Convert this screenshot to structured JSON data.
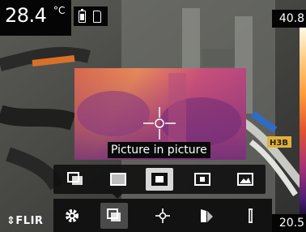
{
  "readout": {
    "value": "28.4",
    "unit": "°C"
  },
  "status": {
    "battery_icon": "battery-icon",
    "sd_card_icon": "sd-card-icon"
  },
  "scale": {
    "max": "40.8",
    "min": "20.5"
  },
  "pip": {
    "caption": "Picture in picture"
  },
  "image_modes": {
    "items": [
      {
        "icon": "fusion-mode-icon",
        "active": false
      },
      {
        "icon": "thermal-mode-icon",
        "active": false
      },
      {
        "icon": "picture-in-picture-icon",
        "active": true
      },
      {
        "icon": "small-pip-icon",
        "active": false
      },
      {
        "icon": "digital-camera-icon",
        "active": false
      }
    ]
  },
  "toolbar": {
    "items": [
      {
        "icon": "settings-gear-icon",
        "selected": false
      },
      {
        "icon": "image-mode-icon",
        "selected": true
      },
      {
        "icon": "spotmeter-crosshair-icon",
        "selected": false
      },
      {
        "icon": "color-palette-icon",
        "selected": false
      },
      {
        "icon": "temperature-scale-icon",
        "selected": false
      }
    ]
  },
  "brand": {
    "logo": "FLIR"
  },
  "colors": {
    "bar_bg": "#121212",
    "active_bg": "#d8d8d8",
    "selected_bg": "#4a4a4a"
  }
}
